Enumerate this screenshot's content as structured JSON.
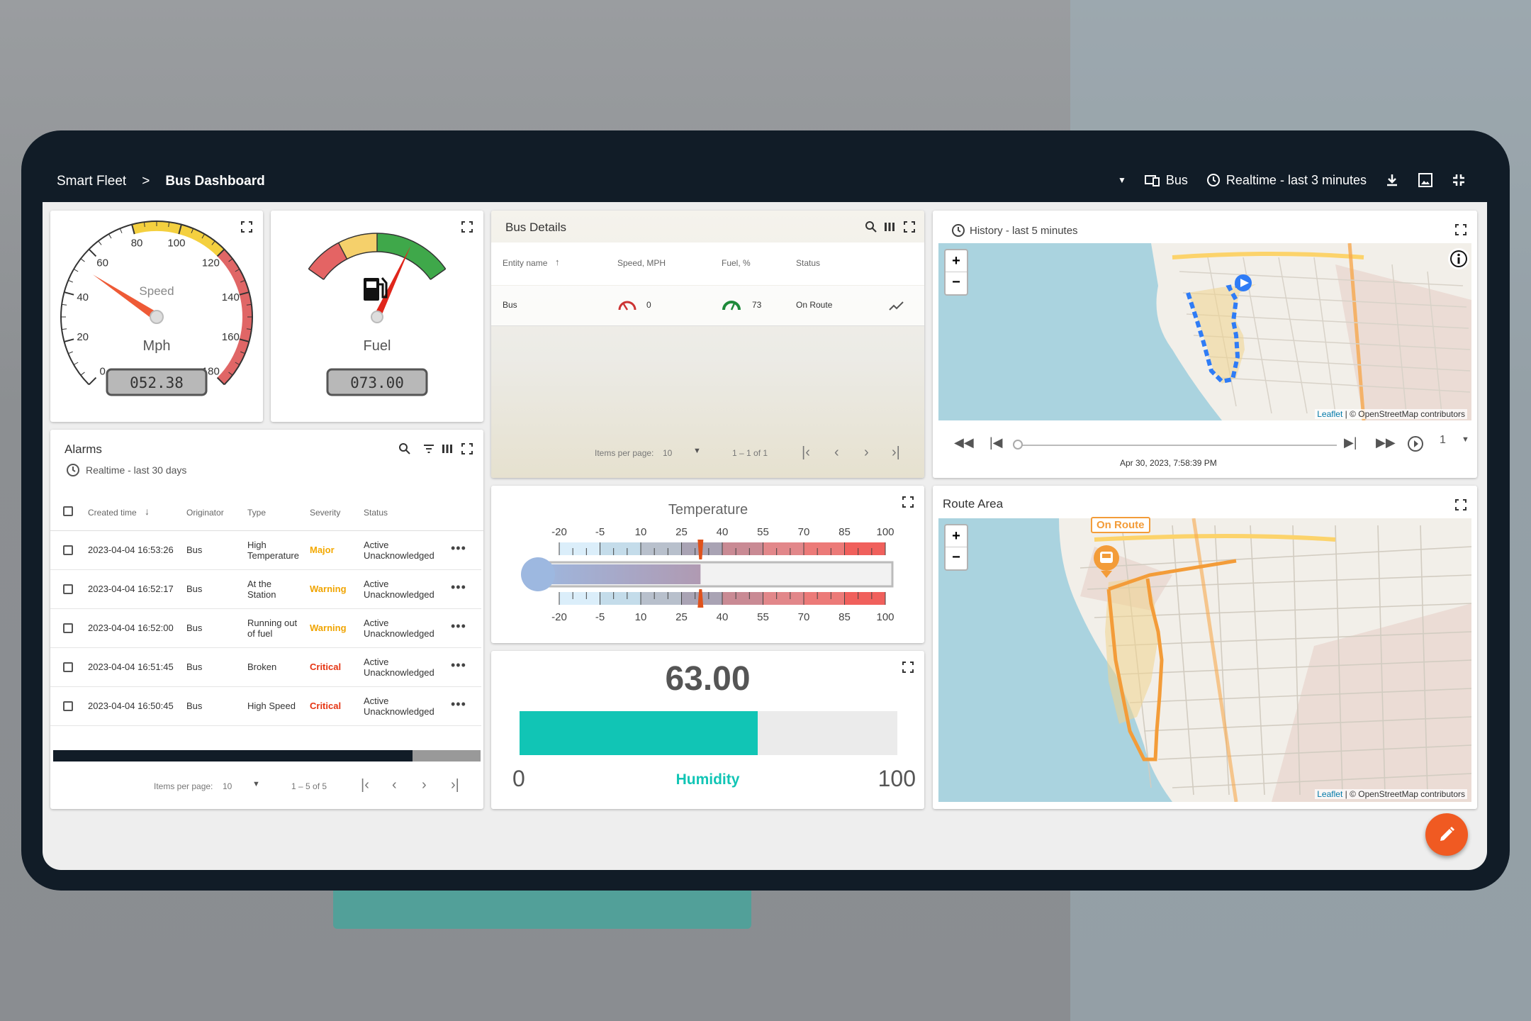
{
  "breadcrumb": {
    "root": "Smart Fleet",
    "sep": ">",
    "current": "Bus Dashboard"
  },
  "toolbar": {
    "entity_label": "Bus",
    "timewindow_label": "Realtime - last 3 minutes"
  },
  "speed_gauge": {
    "title": "Speed",
    "units": "Mph",
    "value": 52.38,
    "display": "052.38",
    "ticks": [
      "0",
      "20",
      "40",
      "60",
      "80",
      "100",
      "120",
      "140",
      "160",
      "180"
    ]
  },
  "fuel_gauge": {
    "title": "Fuel",
    "value": 73,
    "display": "073.00"
  },
  "bus_details": {
    "title": "Bus Details",
    "columns": [
      "Entity name",
      "Speed, MPH",
      "Fuel, %",
      "Status"
    ],
    "rows": [
      {
        "name": "Bus",
        "speed": "0",
        "fuel": "73",
        "status": "On Route"
      }
    ],
    "items_per_page_label": "Items per page:",
    "items_per_page": "10",
    "range": "1 – 1 of 1"
  },
  "history_map": {
    "title": "History - last 5 minutes",
    "attribution_leaflet": "Leaflet",
    "attribution_rest": "| © OpenStreetMap contributors",
    "timestamp": "Apr 30, 2023, 7:58:39 PM",
    "speed_multiplier": "1"
  },
  "alarms": {
    "title": "Alarms",
    "subtitle": "Realtime - last 30 days",
    "columns": [
      "Created time",
      "Originator",
      "Type",
      "Severity",
      "Status"
    ],
    "rows": [
      {
        "time": "2023-04-04 16:53:26",
        "originator": "Bus",
        "type": [
          "High",
          "Temperature"
        ],
        "severity": "Major",
        "sev_color": "#f4a900",
        "status": [
          "Active",
          "Unacknowledged"
        ]
      },
      {
        "time": "2023-04-04 16:52:17",
        "originator": "Bus",
        "type": [
          "At the",
          "Station"
        ],
        "severity": "Warning",
        "sev_color": "#f0a400",
        "status": [
          "Active",
          "Unacknowledged"
        ]
      },
      {
        "time": "2023-04-04 16:52:00",
        "originator": "Bus",
        "type": [
          "Running out",
          "of fuel"
        ],
        "severity": "Warning",
        "sev_color": "#f0a400",
        "status": [
          "Active",
          "Unacknowledged"
        ]
      },
      {
        "time": "2023-04-04 16:51:45",
        "originator": "Bus",
        "type": [
          "Broken",
          ""
        ],
        "severity": "Critical",
        "sev_color": "#e53412",
        "status": [
          "Active",
          "Unacknowledged"
        ]
      },
      {
        "time": "2023-04-04 16:50:45",
        "originator": "Bus",
        "type": [
          "High Speed",
          ""
        ],
        "severity": "Critical",
        "sev_color": "#e53412",
        "status": [
          "Active",
          "Unacknowledged"
        ]
      }
    ],
    "items_per_page_label": "Items per page:",
    "items_per_page": "10",
    "range": "1 – 5 of 5",
    "scroll_fraction": 0.84
  },
  "temperature": {
    "title": "Temperature",
    "value": 32,
    "ticks": [
      "-20",
      "-5",
      "10",
      "25",
      "40",
      "55",
      "70",
      "85",
      "100"
    ]
  },
  "humidity": {
    "value_text": "63.00",
    "value": 63,
    "min": "0",
    "max": "100",
    "label": "Humidity",
    "color": "#11c5b5"
  },
  "route_map": {
    "title": "Route Area",
    "marker_label": "On Route",
    "attribution_leaflet": "Leaflet",
    "attribution_rest": "| © OpenStreetMap contributors"
  },
  "colors": {
    "frame": "#111c27",
    "accent": "#f05a22",
    "route": "#f39c39",
    "track": "#2f7cf6"
  }
}
